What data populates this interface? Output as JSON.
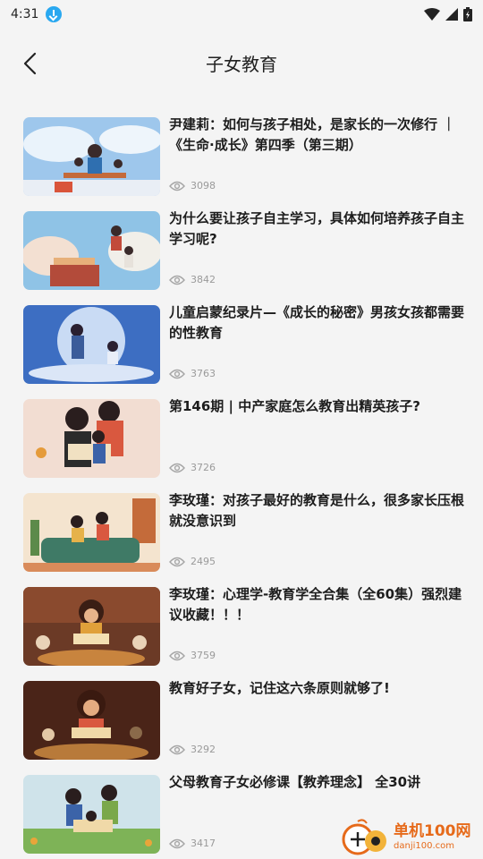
{
  "status_bar": {
    "time": "4:31"
  },
  "header": {
    "title": "子女教育"
  },
  "articles": [
    {
      "title": "尹建莉：如何与孩子相处，是家长的一次修行 ｜《生命·成长》第四季（第三期）",
      "views": "3098"
    },
    {
      "title": "为什么要让孩子自主学习，具体如何培养孩子自主学习呢?",
      "views": "3842"
    },
    {
      "title": "儿童启蒙纪录片—《成长的秘密》男孩女孩都需要的性教育",
      "views": "3763"
    },
    {
      "title": "第146期 | 中产家庭怎么教育出精英孩子?",
      "views": "3726"
    },
    {
      "title": "李玫瑾：对孩子最好的教育是什么，很多家长压根就没意识到",
      "views": "2495"
    },
    {
      "title": "李玫瑾：心理学-教育学全合集（全60集）强烈建议收藏！！！",
      "views": "3759"
    },
    {
      "title": "教育好子女，记住这六条原则就够了!",
      "views": "3292"
    },
    {
      "title": "父母教育子女必修课【教养理念】 全30讲",
      "views": "3417"
    }
  ],
  "watermark": {
    "name": "单机100网",
    "url": "danji100.com"
  },
  "colors": {
    "background": "#f4f4f4",
    "accent": "#e66a1a",
    "download_badge": "#29a8f0"
  }
}
